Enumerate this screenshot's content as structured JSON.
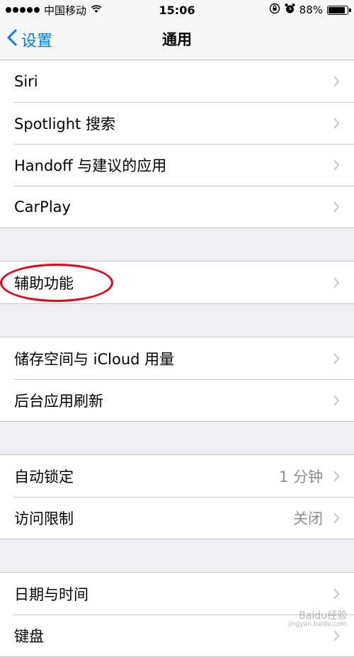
{
  "status_bar": {
    "carrier": "中国移动",
    "time": "15:06",
    "battery_percent": "88%",
    "battery_level": 0.88,
    "icons": [
      "signal-dots-icon",
      "wifi-icon",
      "rotation-lock-icon",
      "alarm-icon",
      "battery-icon"
    ]
  },
  "nav": {
    "back_label": "设置",
    "title": "通用"
  },
  "groups": [
    {
      "items": [
        {
          "label": "Siri"
        },
        {
          "label": "Spotlight 搜索"
        },
        {
          "label": "Handoff 与建议的应用"
        },
        {
          "label": "CarPlay"
        }
      ]
    },
    {
      "items": [
        {
          "label": "辅助功能",
          "highlighted": true
        }
      ]
    },
    {
      "items": [
        {
          "label": "储存空间与 iCloud 用量"
        },
        {
          "label": "后台应用刷新"
        }
      ]
    },
    {
      "items": [
        {
          "label": "自动锁定",
          "value": "1 分钟"
        },
        {
          "label": "访问限制",
          "value": "关闭"
        }
      ]
    },
    {
      "items": [
        {
          "label": "日期与时间"
        },
        {
          "label": "键盘"
        }
      ]
    }
  ],
  "annotation_color": "#e8001a",
  "accent_color": "#007aff",
  "watermark": {
    "text": "Baidu经验",
    "url": "jingyan.baidu.com"
  }
}
